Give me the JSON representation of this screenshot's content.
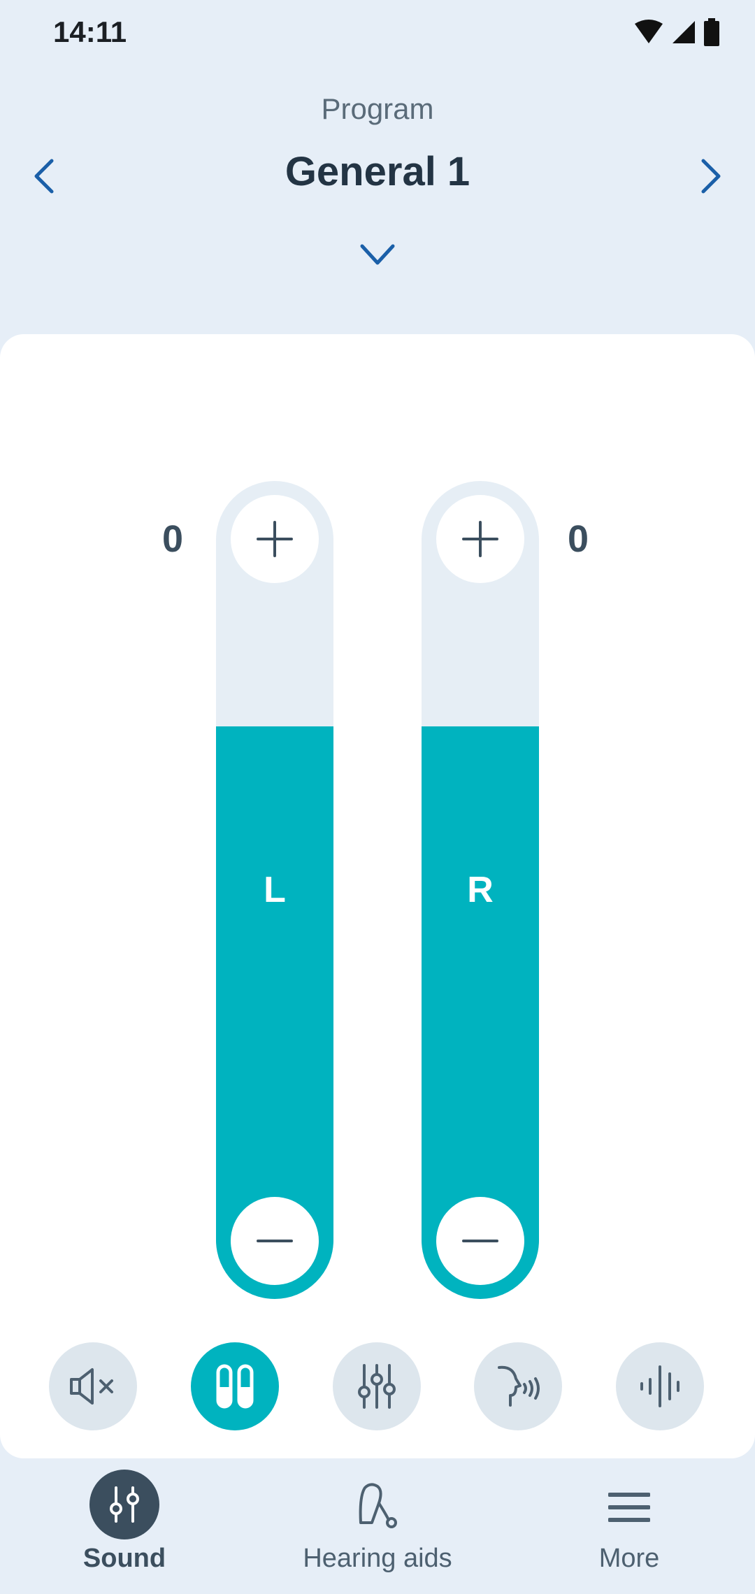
{
  "status_bar": {
    "time": "14:11"
  },
  "program": {
    "label": "Program",
    "name": "General 1"
  },
  "volume": {
    "left": {
      "value": "0",
      "letter": "L",
      "level": 0.7
    },
    "right": {
      "value": "0",
      "letter": "R",
      "level": 0.7
    }
  },
  "actions": [
    "mute-icon",
    "split-volume-icon",
    "equalizer-icon",
    "speech-focus-icon",
    "noise-reduction-icon"
  ],
  "bottom_nav": {
    "sound_label": "Sound",
    "hearing_aids_label": "Hearing aids",
    "more_label": "More"
  },
  "colors": {
    "accent": "#00b3bf",
    "nav_dark": "#3b4e5e",
    "link_blue": "#1a5fa8"
  }
}
